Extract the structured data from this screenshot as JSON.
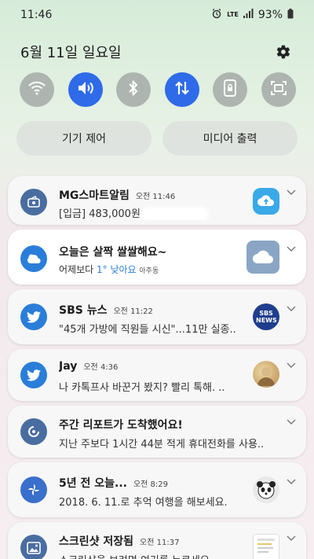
{
  "status_bar": {
    "time": "11:46",
    "network": "LTE",
    "battery": "93%"
  },
  "header": {
    "date": "6월 11일 일요일"
  },
  "quick_settings": [
    {
      "name": "wifi",
      "on": false
    },
    {
      "name": "sound",
      "on": true
    },
    {
      "name": "bluetooth",
      "on": false
    },
    {
      "name": "mobile-data",
      "on": true
    },
    {
      "name": "portrait-lock",
      "on": false
    },
    {
      "name": "screenshot",
      "on": false
    }
  ],
  "pills": {
    "device_control": "기기 제어",
    "media_output": "미디어 출력"
  },
  "notifications": [
    {
      "app": "MG스마트알림",
      "time": "오전 11:46",
      "body": "[입금] 483,000원",
      "icon": "wallet-icon",
      "thumb": "cloud-upload-thumb"
    },
    {
      "title": "오늘은 살짝 쌀쌀해요~",
      "body_prefix": "어제보다",
      "body_highlight": "1° 낮아요",
      "body_suffix": "아주동",
      "icon": "weather-icon",
      "thumb": "cloud-thumb"
    },
    {
      "app": "SBS 뉴스",
      "time": "오전 11:22",
      "body": "\"45개 가방에 직원들 시신\"...11만 실종..",
      "icon": "twitter-icon",
      "thumb_label": "SBS NEWS"
    },
    {
      "app": "Jay",
      "time": "오전 4:36",
      "body": "나 카톡프사 바꾼거 봤지? 빨리 톡해. ..",
      "icon": "twitter-icon",
      "thumb": "profile-thumb"
    },
    {
      "app": "주간 리포트가 도착했어요!",
      "body": "지난 주보다 1시간 44분 적게 휴대전화를 사용..",
      "icon": "wellbeing-icon"
    },
    {
      "app": "5년 전 오늘...",
      "time": "오전 8:29",
      "body": "2018. 6. 11.로 추억 여행을 해보세요.",
      "icon": "pinwheel-icon",
      "thumb": "panda-thumb"
    },
    {
      "app": "스크린샷 저장됨",
      "time": "오전 11:37",
      "body": "스크린샷을 보려면 여기를 누르세요.",
      "icon": "gallery-icon",
      "thumb": "screenshot-thumb"
    }
  ],
  "colors": {
    "accent": "#2f6be8",
    "highlight_text": "#2a7ed9"
  }
}
